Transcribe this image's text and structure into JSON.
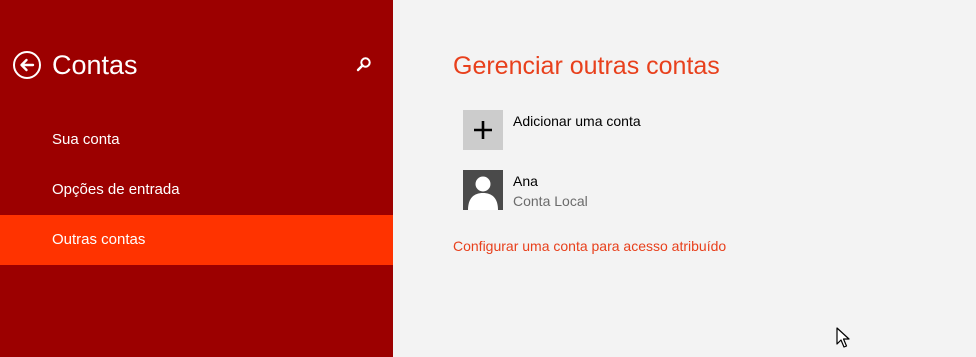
{
  "sidebar": {
    "title": "Contas",
    "back_icon": "back-arrow-icon",
    "search_icon": "search-icon",
    "items": [
      {
        "label": "Sua conta",
        "active": false
      },
      {
        "label": "Opções de entrada",
        "active": false
      },
      {
        "label": "Outras contas",
        "active": true
      }
    ],
    "colors": {
      "background": "#9c0000",
      "active": "#ff3300"
    }
  },
  "main": {
    "title": "Gerenciar outras contas",
    "add_account": {
      "label": "Adicionar uma conta",
      "icon": "plus-icon"
    },
    "accounts": [
      {
        "name": "Ana",
        "type": "Conta Local",
        "icon": "user-avatar-icon"
      }
    ],
    "assigned_access_link": "Configurar uma conta para acesso atribuído",
    "colors": {
      "accent": "#e8401c",
      "background": "#f3f3f3"
    }
  }
}
